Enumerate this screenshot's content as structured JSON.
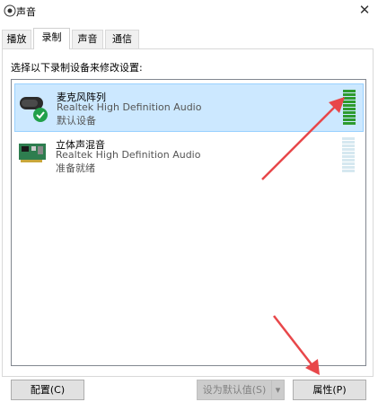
{
  "window": {
    "title": "声音",
    "close_symbol": "✕"
  },
  "tabs": [
    {
      "label": "播放"
    },
    {
      "label": "录制"
    },
    {
      "label": "声音"
    },
    {
      "label": "通信"
    }
  ],
  "instruction": "选择以下录制设备来修改设置:",
  "devices": [
    {
      "name": "麦克风阵列",
      "driver": "Realtek High Definition Audio",
      "status": "默认设备",
      "level": 1.0,
      "default": true,
      "icon": "microphone-array-icon"
    },
    {
      "name": "立体声混音",
      "driver": "Realtek High Definition Audio",
      "status": "准备就绪",
      "level": 0.0,
      "default": false,
      "icon": "sound-card-icon"
    }
  ],
  "buttons": {
    "configure": "配置(C)",
    "set_default": "设为默认值(S)",
    "dropdown": "▾",
    "properties": "属性(P)"
  },
  "colors": {
    "selection": "#cce8ff",
    "meter_active": "#2e9b2e",
    "meter_idle": "#d6e8f0",
    "arrow": "#e8474a"
  }
}
